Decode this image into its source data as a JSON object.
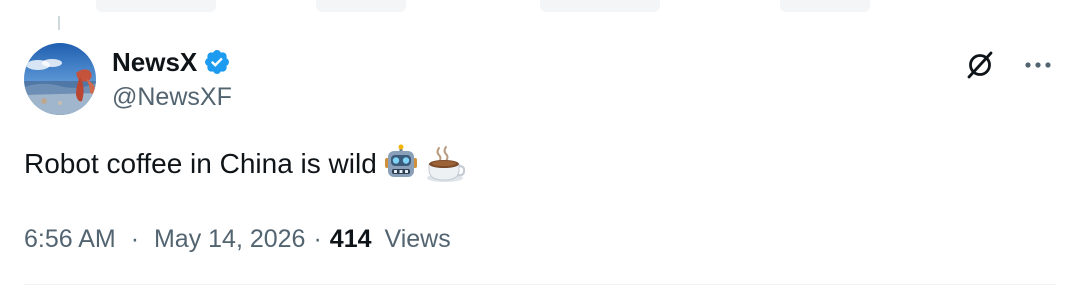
{
  "author": {
    "display_name": "NewsX",
    "handle": "@NewsXF",
    "verified": true,
    "verified_badge_color": "#1d9bf0",
    "avatar_icon": "landscape-avatar"
  },
  "header_icons": {
    "grok": "grok-icon",
    "more": "more-icon"
  },
  "tweet": {
    "text": "Robot coffee in China is wild",
    "emojis": [
      "robot-emoji",
      "hot-beverage-emoji"
    ]
  },
  "meta": {
    "time": "6:56 AM",
    "separator": "·",
    "date": "May 14, 2026",
    "views_count": "414",
    "views_label": "Views"
  },
  "colors": {
    "text_primary": "#0f1419",
    "text_secondary": "#536471",
    "divider": "#eff3f4",
    "accent": "#1d9bf0"
  }
}
